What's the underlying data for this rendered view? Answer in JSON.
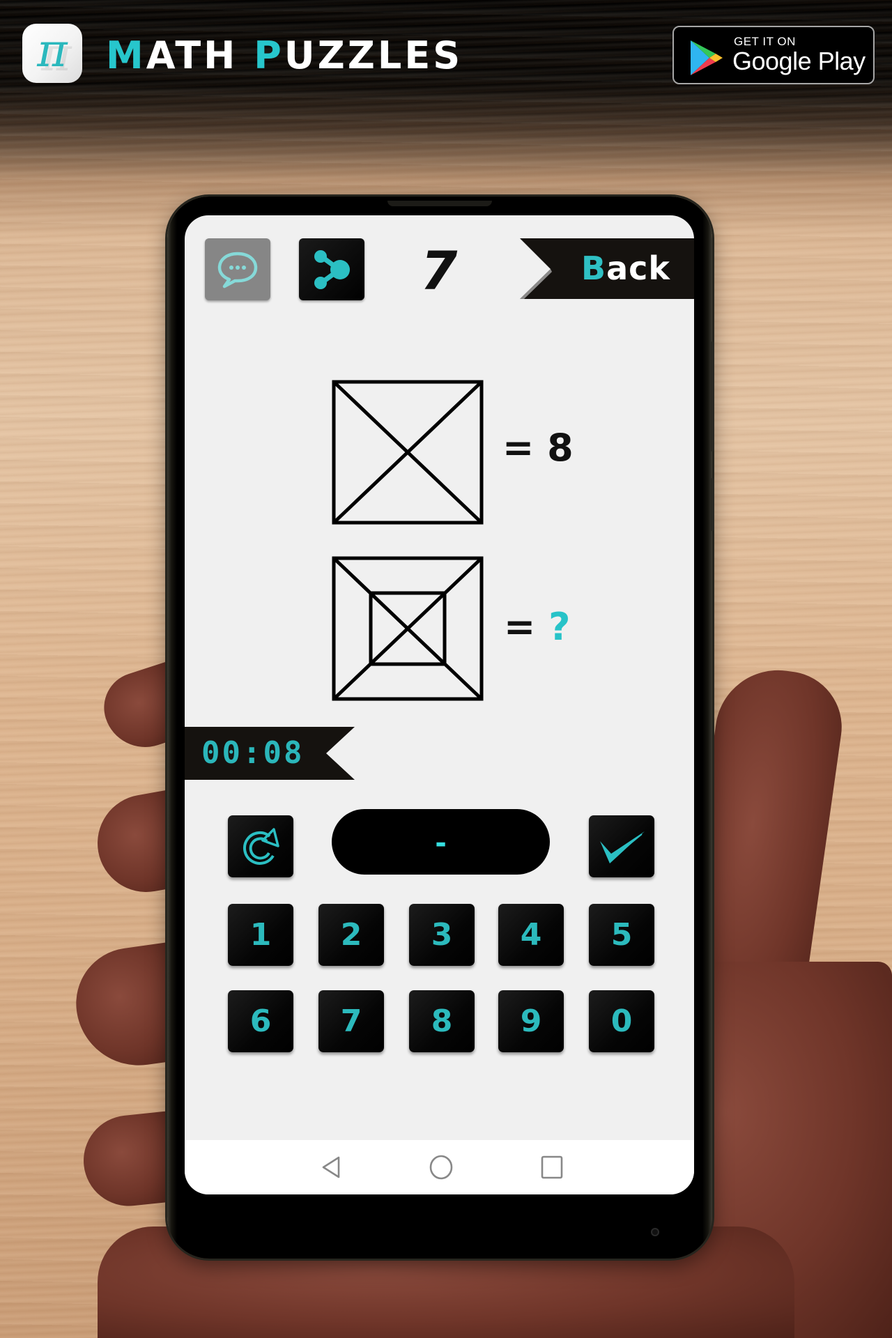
{
  "header": {
    "logo_symbol": "π",
    "title_part1_accent": "M",
    "title_part1_rest": "ATH ",
    "title_part2_accent": "P",
    "title_part2_rest": "UZZLES"
  },
  "store_badge": {
    "small_text": "GET IT ON",
    "store_name": "Google Play"
  },
  "game": {
    "toolbar": {
      "hint_icon": "chat-bubble-icon",
      "share_icon": "share-icon",
      "level_number": "7",
      "back_label_accent": "B",
      "back_label_rest": "ack"
    },
    "puzzle": {
      "line1": {
        "figure": "square with both diagonals",
        "equals": "=",
        "value": "8"
      },
      "line2": {
        "figure": "square with both diagonals and inner square",
        "equals": "=",
        "value": "?"
      }
    },
    "timer": "00:08",
    "answer_display": "-",
    "controls": {
      "reset_icon": "refresh-icon",
      "submit_icon": "check-icon"
    },
    "keypad": [
      "1",
      "2",
      "3",
      "4",
      "5",
      "6",
      "7",
      "8",
      "9",
      "0"
    ]
  },
  "system_nav": {
    "back": "back-triangle-icon",
    "home": "home-circle-icon",
    "recents": "recents-square-icon"
  },
  "colors": {
    "accent_teal": "#2bbfc3",
    "question_teal": "#27c3c8",
    "screen_bg": "#f0f0f0",
    "button_dark": "#000000",
    "hint_button_gray": "#868686"
  }
}
